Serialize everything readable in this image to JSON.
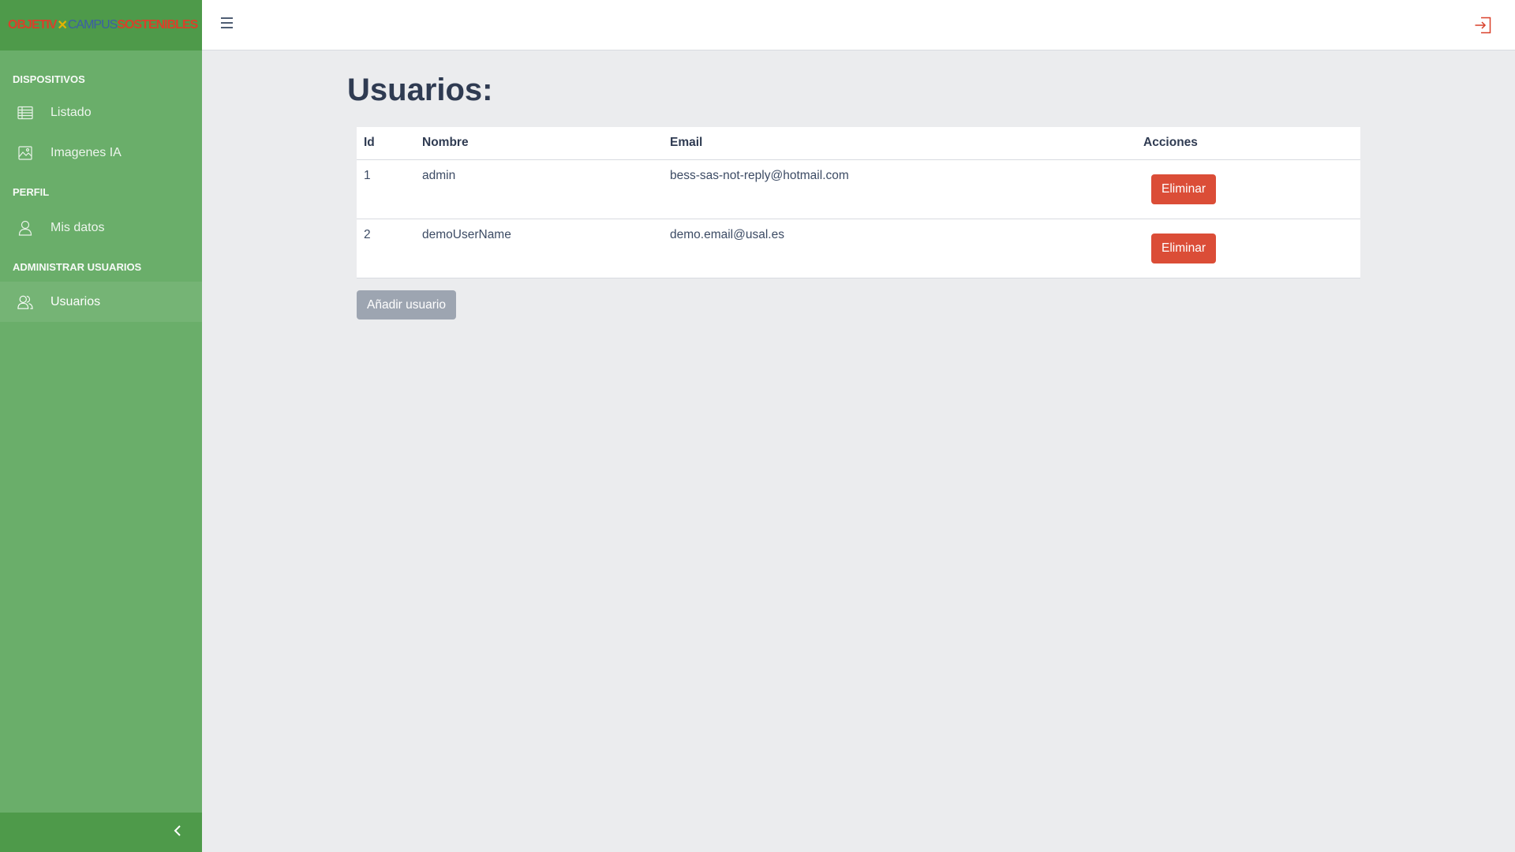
{
  "brand": {
    "part1": "OBJETIV",
    "part2": "✕",
    "part3": "CAMPUS",
    "part4": "SOSTENIBLES"
  },
  "sidebar": {
    "sections": [
      {
        "title": "DISPOSITIVOS"
      },
      {
        "title": "PERFIL"
      },
      {
        "title": "ADMINISTRAR USUARIOS"
      }
    ],
    "items": [
      {
        "label": "Listado",
        "icon": "table-icon"
      },
      {
        "label": "Imagenes IA",
        "icon": "image-icon"
      },
      {
        "label": "Mis datos",
        "icon": "user-icon"
      },
      {
        "label": "Usuarios",
        "icon": "people-icon",
        "active": true
      }
    ]
  },
  "header": {
    "menu_icon": "hamburger-icon",
    "logout_icon": "logout-icon"
  },
  "main": {
    "title": "Usuarios:",
    "table": {
      "columns": [
        "Id",
        "Nombre",
        "Email",
        "Acciones"
      ],
      "rows": [
        {
          "id": "1",
          "name": "admin",
          "email": "bess-sas-not-reply@hotmail.com",
          "action": "Eliminar"
        },
        {
          "id": "2",
          "name": "demoUserName",
          "email": "demo.email@usal.es",
          "action": "Eliminar"
        }
      ]
    },
    "add_button": "Añadir usuario"
  },
  "colors": {
    "sidebar": "#6aae6a",
    "brand_bar": "#4e9a4a",
    "danger": "#db4d37",
    "secondary": "#9da5b1",
    "background": "#ebecee"
  }
}
